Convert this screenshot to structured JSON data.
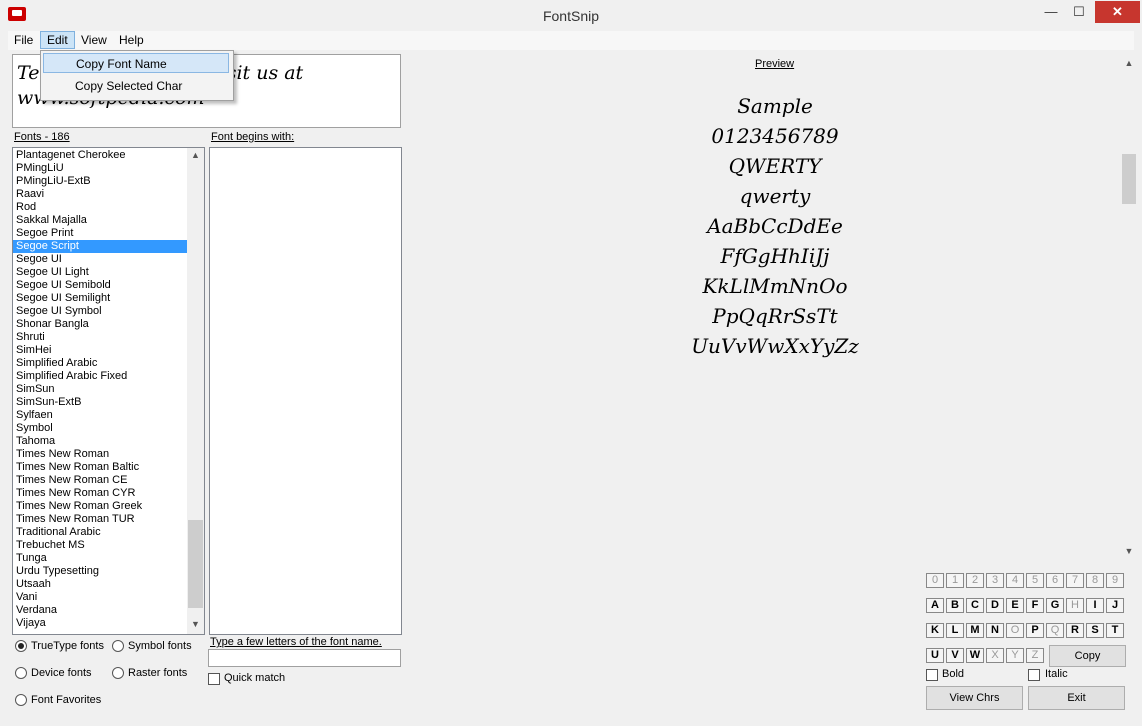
{
  "window": {
    "title": "FontSnip",
    "min": "—",
    "max": "☐",
    "close": "✕"
  },
  "menu": {
    "file": "File",
    "edit": "Edit",
    "view": "View",
    "help": "Help"
  },
  "edit_menu": {
    "copy_font_name": "Copy Font Name",
    "copy_selected_char": "Copy Selected Char"
  },
  "sample_text": {
    "line1": "Te                              isit us at",
    "line2": "www.softpedia.com"
  },
  "fonts": {
    "label": "Fonts - 186",
    "items": [
      "Plantagenet Cherokee",
      "PMingLiU",
      "PMingLiU-ExtB",
      "Raavi",
      "Rod",
      "Sakkal Majalla",
      "Segoe Print",
      "Segoe Script",
      "Segoe UI",
      "Segoe UI Light",
      "Segoe UI Semibold",
      "Segoe UI Semilight",
      "Segoe UI Symbol",
      "Shonar Bangla",
      "Shruti",
      "SimHei",
      "Simplified Arabic",
      "Simplified Arabic Fixed",
      "SimSun",
      "SimSun-ExtB",
      "Sylfaen",
      "Symbol",
      "Tahoma",
      "Times New Roman",
      "Times New Roman Baltic",
      "Times New Roman CE",
      "Times New Roman CYR",
      "Times New Roman Greek",
      "Times New Roman TUR",
      "Traditional Arabic",
      "Trebuchet MS",
      "Tunga",
      "Urdu Typesetting",
      "Utsaah",
      "Vani",
      "Verdana",
      "Vijaya"
    ],
    "selected": "Segoe Script"
  },
  "begins_with": {
    "label": "Font begins with:",
    "hint": "Type a few letters of the font name.",
    "quick_match": "Quick match"
  },
  "font_types": {
    "truetype": "TrueType fonts",
    "symbol": "Symbol fonts",
    "device": "Device fonts",
    "raster": "Raster fonts",
    "favorites": "Font Favorites"
  },
  "preview": {
    "label": "Preview",
    "size": "14",
    "lines": [
      "Sample",
      "0123456789",
      "QWERTY",
      "qwerty",
      "AaBbCcDdEe",
      "FfGgHhIiJj",
      "KkLlMmNnOo",
      "PpQqRrSsTt",
      "UuVvWwXxYyZz"
    ]
  },
  "keys": {
    "row1": [
      "0",
      "1",
      "2",
      "3",
      "4",
      "5",
      "6",
      "7",
      "8",
      "9"
    ],
    "row2": [
      "A",
      "B",
      "C",
      "D",
      "E",
      "F",
      "G",
      "H",
      "I",
      "J"
    ],
    "row3": [
      "K",
      "L",
      "M",
      "N",
      "O",
      "P",
      "Q",
      "R",
      "S",
      "T"
    ],
    "row4": [
      "U",
      "V",
      "W",
      "X",
      "Y",
      "Z"
    ]
  },
  "buttons": {
    "copy": "Copy",
    "view_chrs": "View Chrs",
    "exit": "Exit",
    "bold": "Bold",
    "italic": "Italic"
  }
}
